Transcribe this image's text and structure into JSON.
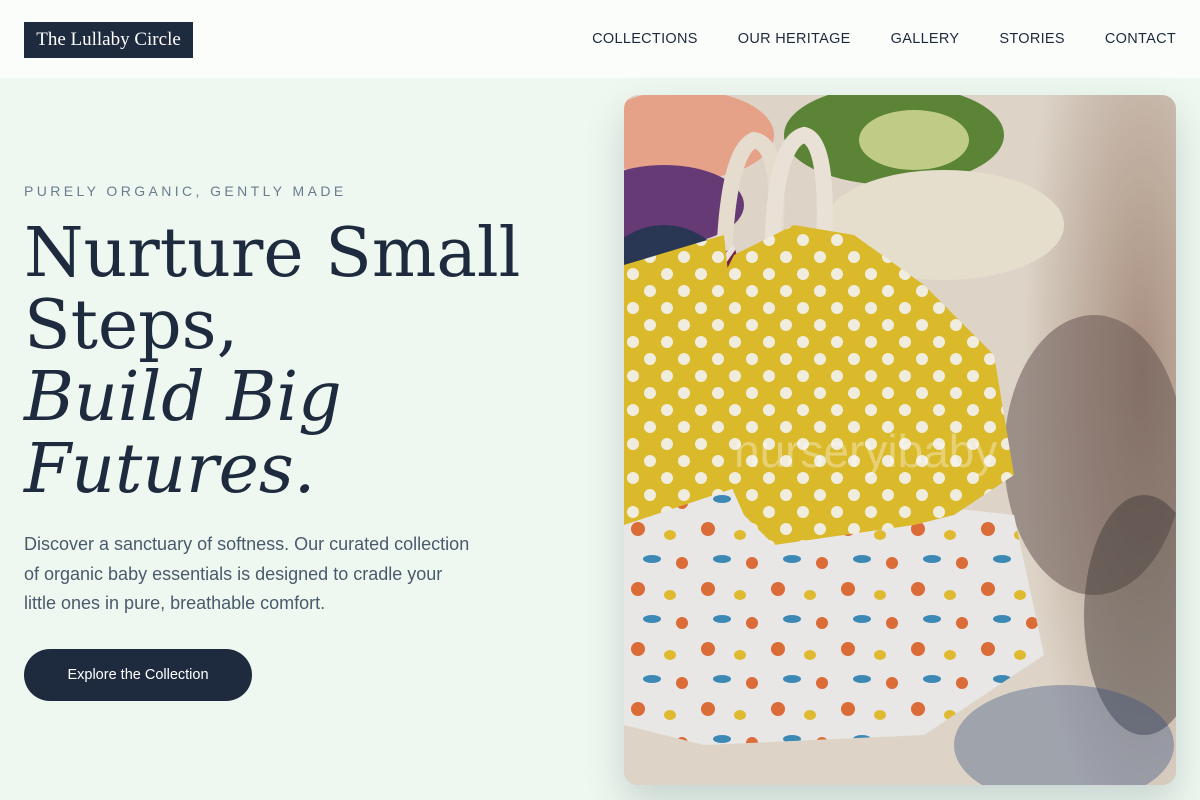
{
  "brand": {
    "logo_text": "The Lullaby Circle"
  },
  "nav": {
    "items": [
      {
        "label": "COLLECTIONS"
      },
      {
        "label": "OUR HERITAGE"
      },
      {
        "label": "GALLERY"
      },
      {
        "label": "STORIES"
      },
      {
        "label": "CONTACT"
      }
    ]
  },
  "hero": {
    "eyebrow": "PURELY ORGANIC, GENTLY MADE",
    "headline": {
      "line1": "Nurture Small",
      "line2": "Steps,",
      "line3_italic": "Build Big",
      "line4_italic": "Futures."
    },
    "description": "Discover a sanctuary of softness. Our curated collection of organic baby essentials is designed to cradle your little ones in pure, breathable comfort.",
    "cta_label": "Explore the Collection",
    "image": {
      "subject": "baby-clothes-on-hangers-photo",
      "watermark": "nurseryibaby"
    }
  },
  "colors": {
    "background": "#eef8f0",
    "header_background": "#fbfdfb",
    "primary_dark": "#1e2a3e",
    "body_text": "#4a5a6c",
    "eyebrow_text": "#6b7c8f",
    "accent_yellow": "#e6c52e"
  }
}
